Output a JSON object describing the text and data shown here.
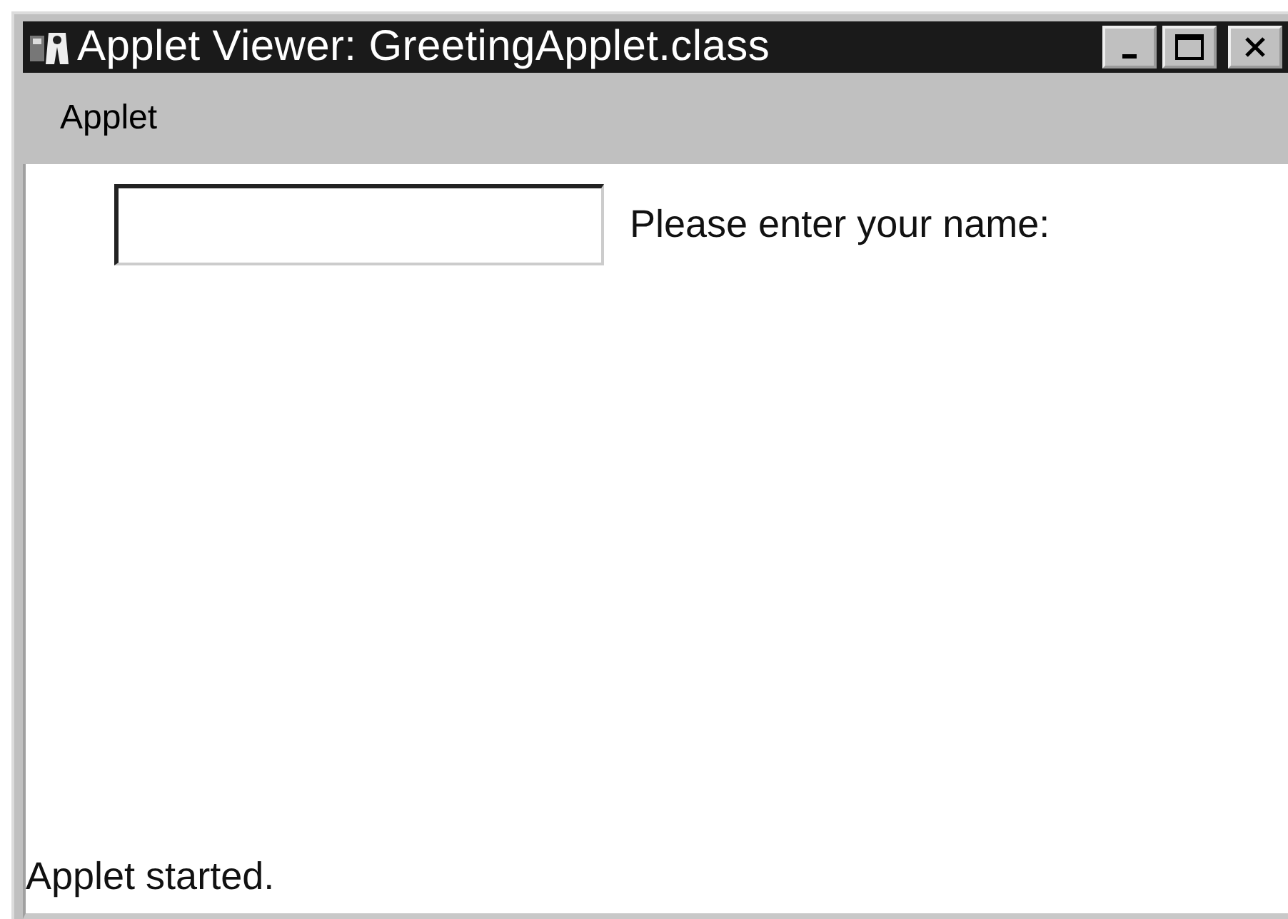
{
  "window": {
    "title": "Applet Viewer: GreetingApplet.class"
  },
  "menu_bar": {
    "items": [
      {
        "label": "Applet"
      }
    ]
  },
  "applet": {
    "prompt": "Please enter your name:"
  },
  "status_bar": {
    "text": "Applet started."
  }
}
